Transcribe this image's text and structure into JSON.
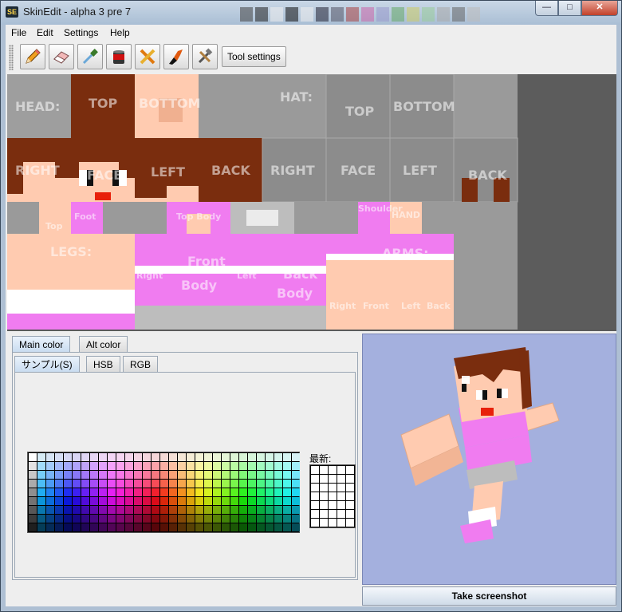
{
  "window": {
    "title": "SkinEdit - alpha 3 pre 7",
    "app_icon_text": "SE"
  },
  "menu": [
    "File",
    "Edit",
    "Settings",
    "Help"
  ],
  "toolbar": {
    "tools": [
      "pencil-icon",
      "eraser-icon",
      "eyedropper-icon",
      "paint-bucket-icon",
      "noise-icon",
      "burn-icon",
      "settings-tools-icon"
    ],
    "tool_settings_label": "Tool settings"
  },
  "skin_labels": {
    "head": "HEAD:",
    "head_top": "TOP",
    "head_bottom": "BOTTOM",
    "hat": "HAT:",
    "hat_top": "TOP",
    "hat_bottom": "BOTTOM",
    "head_right": "RIGHT",
    "head_face": "FACE",
    "head_left": "LEFT",
    "head_back": "BACK",
    "hat_right": "RIGHT",
    "hat_face": "FACE",
    "hat_left": "LEFT",
    "hat_back": "BACK",
    "legs": "LEGS:",
    "foot": "Foot",
    "leg_top": "Top",
    "top_body": "Top Body",
    "shoulder": "Shoulder",
    "hand": "HAND",
    "front_body": "Front",
    "body": "Body",
    "back_body": "Back",
    "body2": "Body",
    "right": "Right",
    "left": "Left",
    "arms": "ARMS:",
    "leg_right": "Right",
    "leg_left": "Left",
    "arm_right": "Right",
    "arm_front": "Front",
    "arm_left": "Left",
    "arm_back": "Back"
  },
  "color_panel": {
    "main_tabs": [
      "Main color",
      "Alt color"
    ],
    "sub_tabs": [
      "サンプル(S)",
      "HSB",
      "RGB"
    ],
    "recent_label": "最新:"
  },
  "preview": {
    "screenshot_button": "Take screenshot"
  },
  "colors": {
    "skin": "#ffcbb0",
    "hair": "#7a2d0e",
    "pink": "#f07cf0",
    "mouth": "#e8200a",
    "preview_bg": "#a4b0de"
  }
}
